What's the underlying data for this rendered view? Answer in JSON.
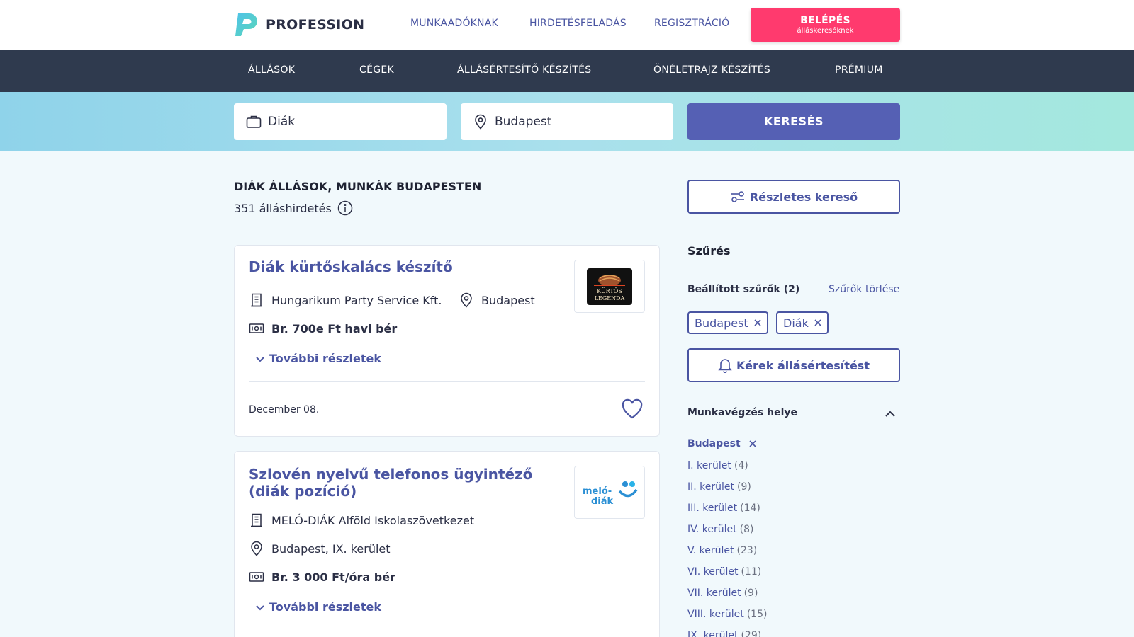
{
  "header": {
    "brand": "PROFESSION",
    "nav": [
      "MUNKAADÓKNAK",
      "HIRDETÉSFELADÁS",
      "REGISZTRÁCIÓ"
    ],
    "login_label": "BELÉPÉS",
    "login_sub": "álláskeresőknek",
    "accent_color": "#ff3a6e"
  },
  "main_nav": [
    "ÁLLÁSOK",
    "CÉGEK",
    "ÁLLÁSÉRTESÍTŐ KÉSZÍTÉS",
    "ÖNÉLETRAJZ KÉSZÍTÉS",
    "PRÉMIUM"
  ],
  "search": {
    "keyword_value": "Diák",
    "location_value": "Budapest",
    "button_label": "KERESÉS"
  },
  "results": {
    "title": "DIÁK ÁLLÁSOK, MUNKÁK BUDAPESTEN",
    "count": "351 álláshirdetés"
  },
  "jobs": [
    {
      "title": "Diák kürtőskalács készítő",
      "company": "Hungarikum Party Service Kft.",
      "location": "Budapest",
      "salary": "Br. 700e Ft havi bér",
      "more": "További részletek",
      "date": "December 08.",
      "logo_text_top": "KÜRTŐS",
      "logo_text_bottom": "LEGENDA"
    },
    {
      "title": "Szlovén nyelvű telefonos ügyintéző (diák pozíció)",
      "company": "MELÓ-DIÁK Alföld Iskolaszövetkezet",
      "location": "Budapest, IX. kerület",
      "salary": "Br. 3 000 Ft/óra bér",
      "more": "További részletek",
      "logo_text_top": "meló-",
      "logo_text_bottom": "diák"
    }
  ],
  "sidebar": {
    "detail_search_label": "Részletes kereső",
    "filter_title": "Szűrés",
    "set_filters_label": "Beállított szűrők (2)",
    "clear_filters_label": "Szűrők törlése",
    "chips": [
      "Budapest",
      "Diák"
    ],
    "alert_label": "Kérek állásértesítést",
    "location_section": "Munkavégzés helye",
    "selected_location": "Budapest",
    "districts": [
      {
        "name": "I. kerület",
        "count": "(4)"
      },
      {
        "name": "II. kerület",
        "count": "(9)"
      },
      {
        "name": "III. kerület",
        "count": "(14)"
      },
      {
        "name": "IV. kerület",
        "count": "(8)"
      },
      {
        "name": "V. kerület",
        "count": "(23)"
      },
      {
        "name": "VI. kerület",
        "count": "(11)"
      },
      {
        "name": "VII. kerület",
        "count": "(9)"
      },
      {
        "name": "VIII. kerület",
        "count": "(15)"
      },
      {
        "name": "IX. kerület",
        "count": "(29)"
      }
    ]
  }
}
